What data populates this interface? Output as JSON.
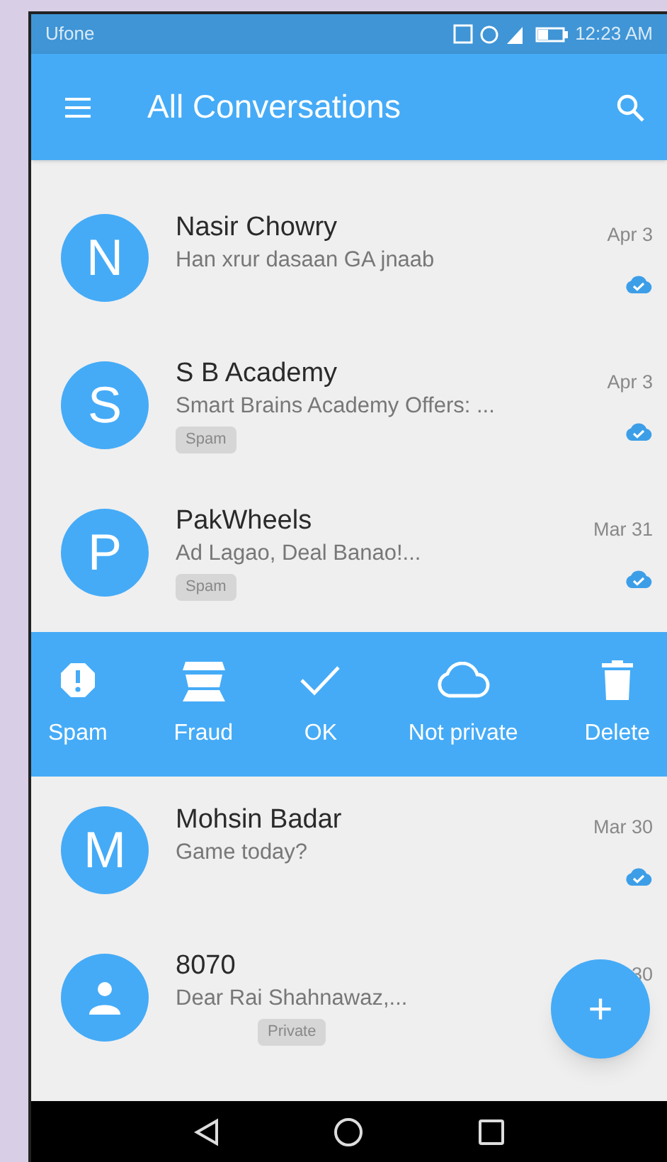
{
  "status_bar": {
    "carrier": "Ufone",
    "time": "12:23 AM"
  },
  "app_bar": {
    "title": "All Conversations"
  },
  "conversations": [
    {
      "avatar": {
        "kind": "letter",
        "letter": "N"
      },
      "name": "Nasir Chowry",
      "snippet": "Han xrur dasaan GA jnaab",
      "date": "Apr 3",
      "synced": true
    },
    {
      "avatar": {
        "kind": "letter",
        "letter": "S"
      },
      "name": "S B Academy",
      "snippet": "Smart Brains Academy Offers: ...",
      "date": "Apr 3",
      "tag": "Spam",
      "synced": true
    },
    {
      "avatar": {
        "kind": "letter",
        "letter": "P"
      },
      "name": "PakWheels",
      "snippet": "Ad Lagao, Deal Banao!...",
      "date": "Mar 31",
      "tag": "Spam",
      "synced": true
    }
  ],
  "actions": [
    {
      "kind": "spam",
      "label": "Spam"
    },
    {
      "kind": "fraud",
      "label": "Fraud"
    },
    {
      "kind": "ok",
      "label": "OK"
    },
    {
      "kind": "cloud",
      "label": "Not private"
    },
    {
      "kind": "delete",
      "label": "Delete"
    }
  ],
  "conversations_below": [
    {
      "avatar": {
        "kind": "letter",
        "letter": "M"
      },
      "name": "Mohsin Badar",
      "snippet": "Game today?",
      "date": "Mar 30",
      "synced": true
    },
    {
      "avatar": {
        "kind": "person"
      },
      "name": "8070",
      "snippet": "Dear Rai Shahnawaz,...",
      "date": "30",
      "tag": "Private",
      "synced": false
    }
  ],
  "fab": {
    "label": "+"
  }
}
